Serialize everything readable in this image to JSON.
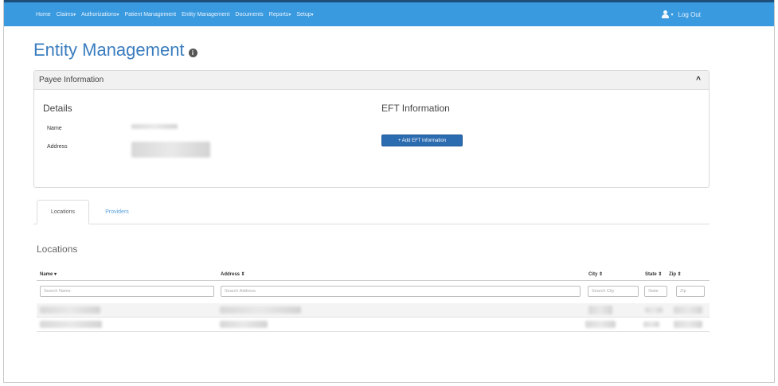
{
  "nav": {
    "items": [
      {
        "label": "Home",
        "caret": false
      },
      {
        "label": "Claims",
        "caret": true
      },
      {
        "label": "Authorizations",
        "caret": true
      },
      {
        "label": "Patient Management",
        "caret": false
      },
      {
        "label": "Entity Management",
        "caret": false
      },
      {
        "label": "Documents",
        "caret": false
      },
      {
        "label": "Reports",
        "caret": true
      },
      {
        "label": "Setup",
        "caret": true
      }
    ],
    "caret_char": "▾",
    "logout_label": "Log Out",
    "user_icon": "user-icon"
  },
  "page": {
    "title": "Entity Management",
    "info_icon_glyph": "i"
  },
  "payee_panel": {
    "title": "Payee Information",
    "collapse_glyph": "^",
    "details_title": "Details",
    "name_label": "Name",
    "address_label": "Address",
    "eft_title": "EFT Information",
    "add_eft_button": "+ Add EFT Information"
  },
  "tabs": {
    "locations": "Locations",
    "providers": "Providers"
  },
  "locations": {
    "heading": "Locations",
    "columns": {
      "name": "Name ▾",
      "address": "Address ⇕",
      "city": "City ⇕",
      "state": "State ⇕",
      "zip": "Zip ⇕"
    },
    "filters": {
      "name_placeholder": "Search Name",
      "address_placeholder": "Search Address",
      "city_placeholder": "Search City",
      "state_placeholder": "State",
      "zip_placeholder": "Zip"
    }
  },
  "colors": {
    "navbar": "#3a9ae0",
    "title": "#3a7dbf",
    "button": "#2b6bb0",
    "tab_link": "#5aa0dc"
  }
}
